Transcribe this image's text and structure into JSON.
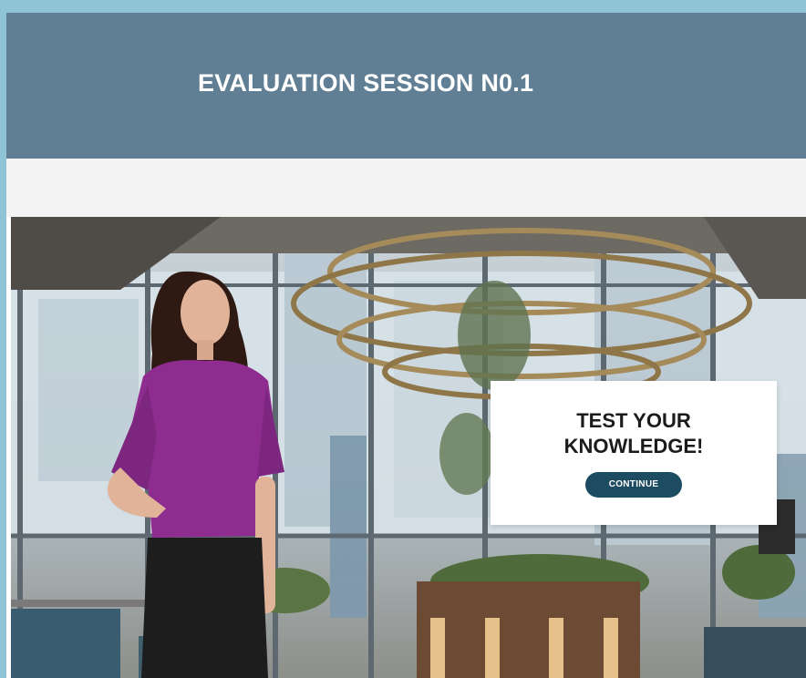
{
  "header": {
    "title": "EVALUATION SESSION N0.1"
  },
  "card": {
    "title_line1": "TEST YOUR",
    "title_line2": "KNOWLEDGE!",
    "button_label": "CONTINUE"
  },
  "colors": {
    "outer_border": "#8fc3d6",
    "header_bg": "#617f94",
    "gap_bar": "#f3f3f3",
    "button_bg": "#1d4b62",
    "blouse": "#8e2d8f",
    "skirt": "#1d1d1d"
  }
}
